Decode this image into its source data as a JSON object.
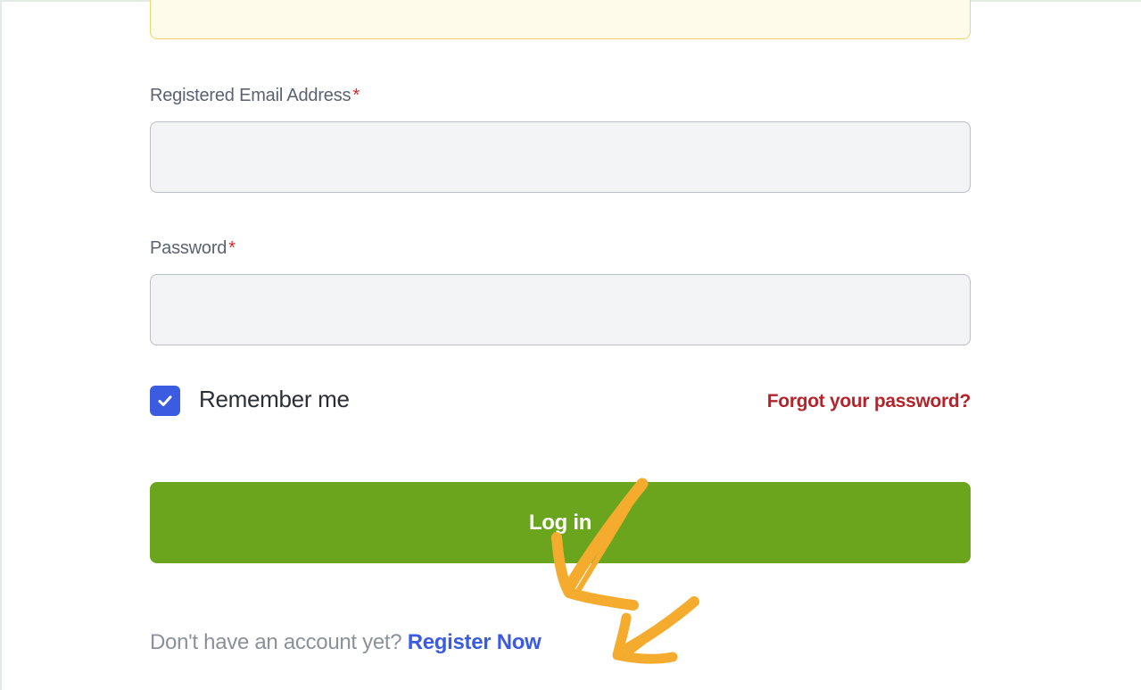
{
  "form": {
    "email": {
      "label": "Registered Email Address",
      "required_marker": "*",
      "value": "",
      "placeholder": ""
    },
    "password": {
      "label": "Password",
      "required_marker": "*",
      "value": "",
      "placeholder": ""
    },
    "remember": {
      "label": "Remember me",
      "checked": true
    },
    "forgot_link": "Forgot your password?",
    "login_button": "Log in",
    "register": {
      "prompt": "Don't have an account yet?",
      "link": "Register Now"
    }
  },
  "colors": {
    "accent_green": "#6aa51d",
    "link_blue": "#3b5be0",
    "forgot_red": "#b4232a",
    "annotation_arrow": "#f5ac2e"
  },
  "icons": {
    "checkbox": "check-icon",
    "annotation": "arrow-annotation"
  }
}
